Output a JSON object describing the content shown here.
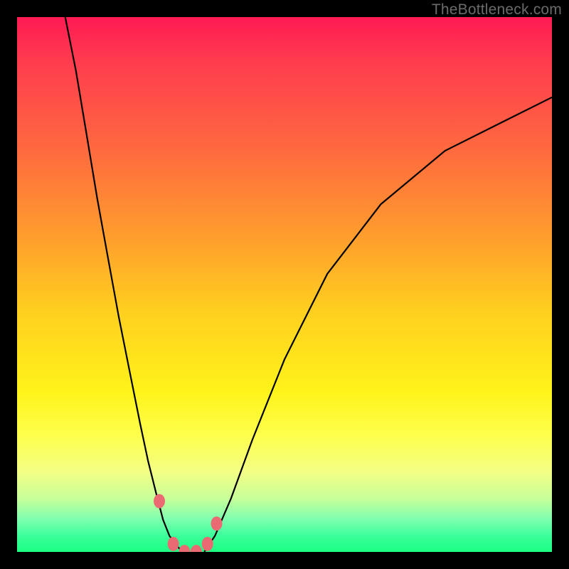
{
  "watermark": "TheBottleneck.com",
  "colors": {
    "background_black": "#000000",
    "marker": "#e96a72",
    "curve_stroke": "#000000",
    "gradient_top": "#ff1a54",
    "gradient_bottom": "#1bff82"
  },
  "chart_data": {
    "type": "line",
    "title": "",
    "xlabel": "",
    "ylabel": "",
    "xlim": [
      0,
      100
    ],
    "ylim": [
      0,
      100
    ],
    "series": [
      {
        "name": "left-arm",
        "x": [
          9,
          11,
          13,
          15,
          17,
          19,
          21,
          23,
          24.5,
          26,
          27.3,
          28.5,
          30,
          31
        ],
        "values": [
          100,
          90,
          78,
          66,
          55,
          44,
          34,
          24,
          17,
          11,
          6,
          3,
          1,
          0
        ]
      },
      {
        "name": "right-arm",
        "x": [
          35,
          37,
          40,
          44,
          50,
          58,
          68,
          80,
          92,
          100
        ],
        "values": [
          0,
          3,
          10,
          21,
          36,
          52,
          65,
          75,
          81,
          85
        ]
      }
    ],
    "markers": {
      "name": "highlighted-points",
      "points": [
        {
          "x": 26.6,
          "y": 9.5
        },
        {
          "x": 29.2,
          "y": 1.5
        },
        {
          "x": 31.3,
          "y": 0.0
        },
        {
          "x": 33.5,
          "y": 0.0
        },
        {
          "x": 35.6,
          "y": 1.5
        },
        {
          "x": 37.3,
          "y": 5.3
        }
      ]
    }
  }
}
